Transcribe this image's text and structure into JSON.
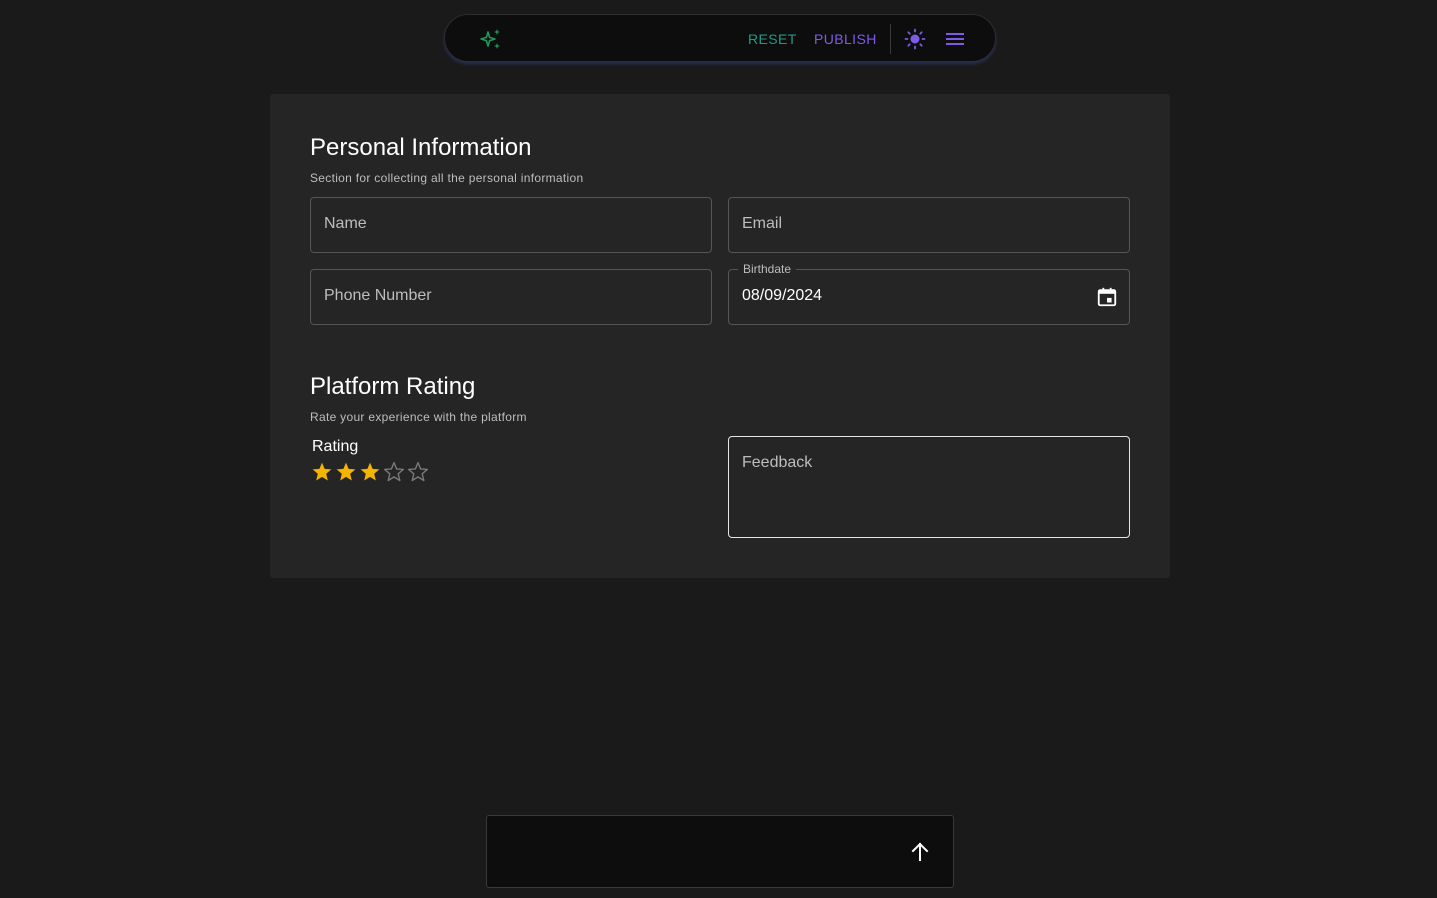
{
  "toolbar": {
    "logo_icon": "sparkles-icon",
    "reset_label": "RESET",
    "publish_label": "PUBLISH",
    "theme_icon": "sun-icon",
    "menu_icon": "menu-icon",
    "colors": {
      "reset": "#1f9a85",
      "publish": "#7c5ce6",
      "logo": "#1f9a5a"
    }
  },
  "personal": {
    "title": "Personal Information",
    "description": "Section for collecting all the personal information",
    "name_placeholder": "Name",
    "email_placeholder": "Email",
    "phone_placeholder": "Phone Number",
    "birthdate_label": "Birthdate",
    "birthdate_value": "08/09/2024",
    "calendar_icon": "calendar-icon"
  },
  "rating": {
    "title": "Platform Rating",
    "description": "Rate your experience with the platform",
    "label": "Rating",
    "value": 3,
    "max": 5,
    "star_color": "#f5b400",
    "feedback_placeholder": "Feedback"
  },
  "bottom": {
    "submit_icon": "arrow-up-icon"
  }
}
